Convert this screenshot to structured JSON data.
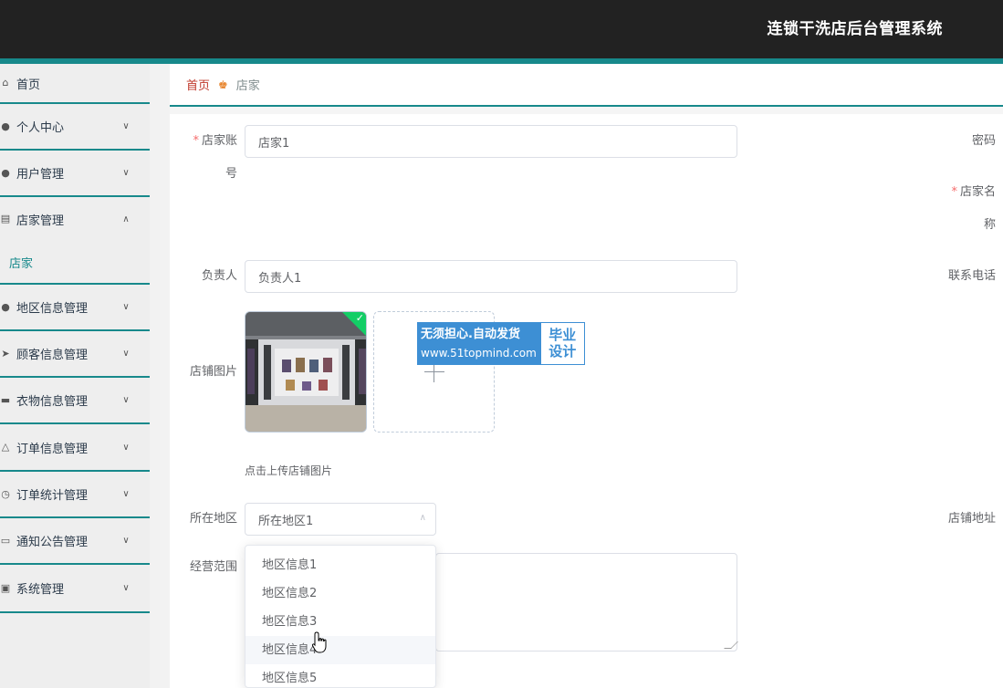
{
  "header": {
    "system_title": "连锁干洗店后台管理系统"
  },
  "sidebar": {
    "items": [
      {
        "label": "首页",
        "icon": "home-icon",
        "glyph": "⌂",
        "expanded": null
      },
      {
        "label": "个人中心",
        "icon": "user-icon",
        "glyph": "●",
        "expanded": false
      },
      {
        "label": "用户管理",
        "icon": "bulb-icon",
        "glyph": "●",
        "expanded": false
      },
      {
        "label": "店家管理",
        "icon": "chart-icon",
        "glyph": "▤",
        "expanded": true
      },
      {
        "label": "地区信息管理",
        "icon": "user-icon",
        "glyph": "●",
        "expanded": false
      },
      {
        "label": "顾客信息管理",
        "icon": "send-icon",
        "glyph": "➤",
        "expanded": false
      },
      {
        "label": "衣物信息管理",
        "icon": "cart-icon",
        "glyph": "▬",
        "expanded": false
      },
      {
        "label": "订单信息管理",
        "icon": "bell-icon",
        "glyph": "△",
        "expanded": false
      },
      {
        "label": "订单统计管理",
        "icon": "clock-icon",
        "glyph": "◷",
        "expanded": false
      },
      {
        "label": "通知公告管理",
        "icon": "chat-icon",
        "glyph": "▭",
        "expanded": false
      },
      {
        "label": "系统管理",
        "icon": "clipboard-icon",
        "glyph": "▣",
        "expanded": false
      }
    ],
    "sub_item": "店家",
    "arrow_down": "∨",
    "arrow_up": "∧"
  },
  "breadcrumb": {
    "home": "首页",
    "separator": "♚",
    "current": "店家"
  },
  "form": {
    "account_label_line1": "店家账",
    "account_label_line2": "号",
    "account_value": "店家1",
    "password_label": "密码",
    "name_label_line1": "店家名",
    "name_label_line2": "称",
    "manager_label": "负责人",
    "manager_value": "负责人1",
    "phone_label": "联系电话",
    "image_label": "店铺图片",
    "upload_hint": "点击上传店铺图片",
    "region_label": "所在地区",
    "region_value": "所在地区1",
    "address_label": "店铺地址",
    "scope_label": "经营范围",
    "required_mark": "*",
    "check_mark": "✓",
    "select_arrow": "∧"
  },
  "dropdown": {
    "options": [
      "地区信息1",
      "地区信息2",
      "地区信息3",
      "地区信息4",
      "地区信息5"
    ],
    "hovered_index": 3
  },
  "watermark": {
    "line1": "无须担心.自动发货",
    "line2": "www.51topmind.com",
    "right1": "毕业",
    "right2": "设计"
  },
  "colors": {
    "accent": "#17898b",
    "header_bg": "#222222",
    "required": "#f56c6c"
  }
}
